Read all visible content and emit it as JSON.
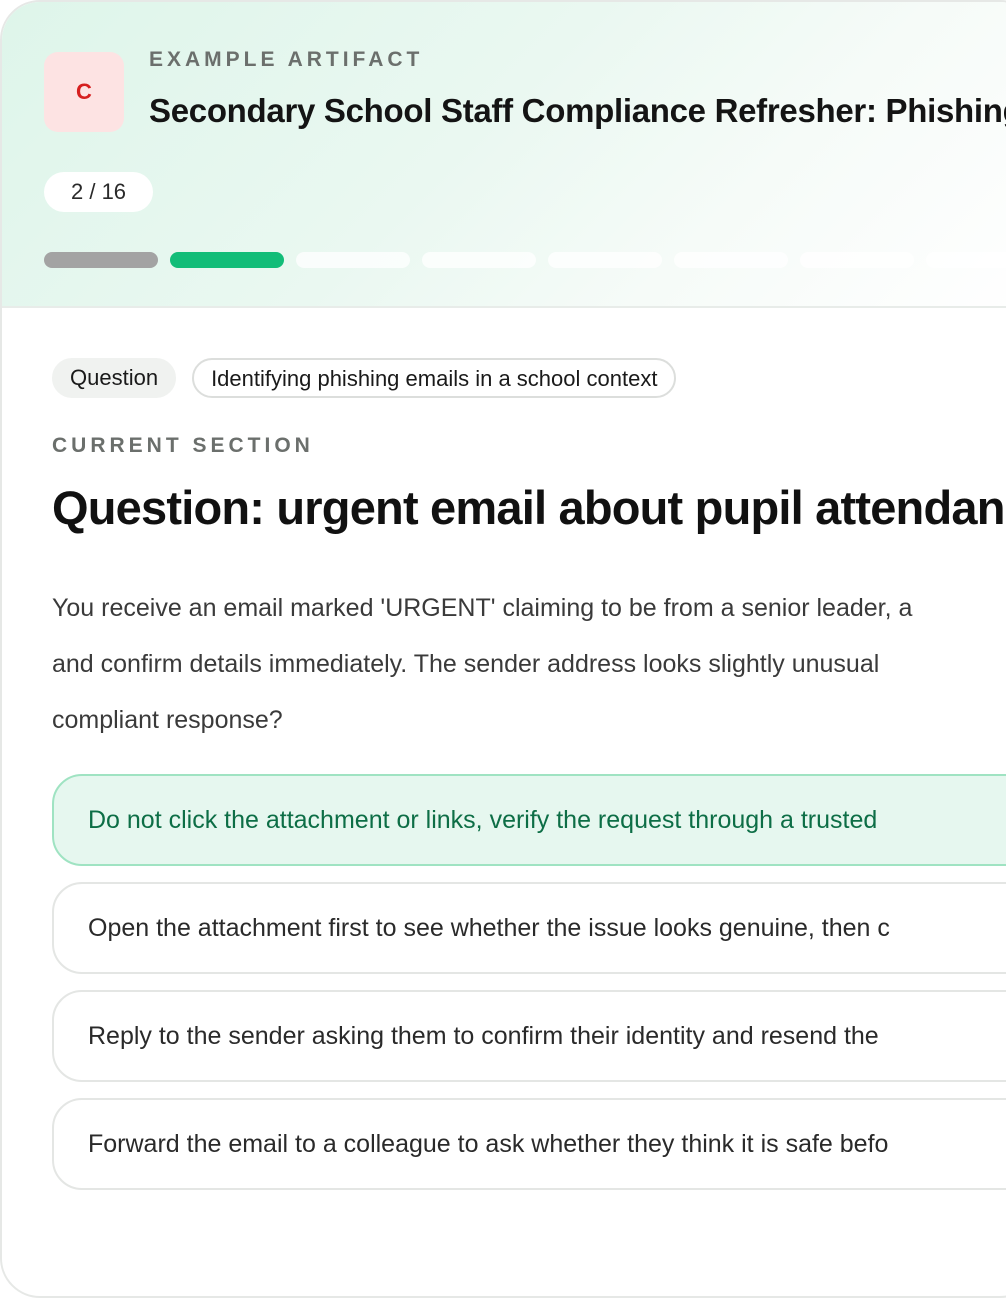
{
  "header": {
    "logo_letter": "C",
    "kicker": "EXAMPLE ARTIFACT",
    "title": "Secondary School Staff Compliance Refresher: Phishing",
    "counter": "2 / 16",
    "progress": {
      "current": 2,
      "total": 16
    }
  },
  "tags": {
    "type": "Question",
    "topic": "Identifying phishing emails in a school context"
  },
  "section_label": "CURRENT SECTION",
  "question": {
    "heading": "Question: urgent email about pupil attendance",
    "body_lines": [
      "You receive an email marked 'URGENT' claiming to be from a senior leader, a",
      "and confirm details immediately. The sender address looks slightly unusual",
      "compliant response?"
    ]
  },
  "options": [
    {
      "text": "Do not click the attachment or links, verify the request through a trusted",
      "selected": true
    },
    {
      "text": "Open the attachment first to see whether the issue looks genuine, then c",
      "selected": false
    },
    {
      "text": "Reply to the sender asking them to confirm their identity and resend the",
      "selected": false
    },
    {
      "text": "Forward the email to a colleague to ask whether they think it is safe befo",
      "selected": false
    }
  ],
  "colors": {
    "accent": "#12bd78",
    "selected_bg": "#e6f7ef",
    "selected_text": "#0d6e46",
    "logo_bg": "#fde3e3",
    "logo_text": "#d61f1f"
  }
}
